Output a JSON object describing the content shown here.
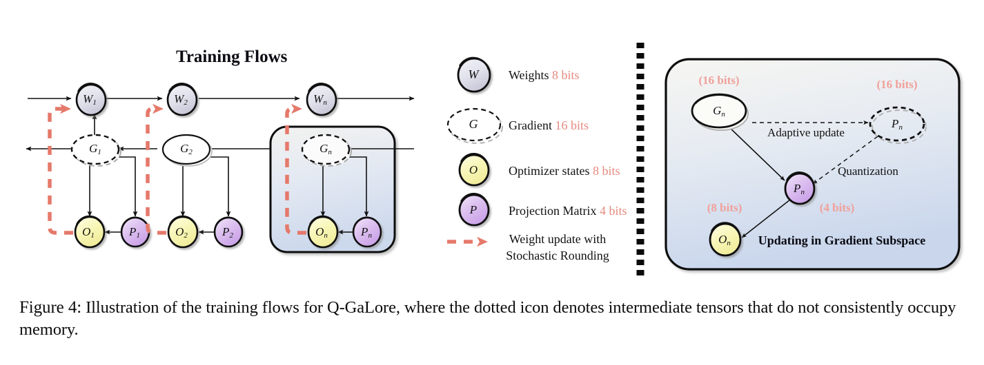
{
  "figure": {
    "caption_label": "Figure 4:",
    "caption_text": " Illustration of the training flows for Q-GaLore, where the dotted icon denotes intermediate tensors that do not consistently occupy memory."
  },
  "left_panel": {
    "title": "Training Flows",
    "nodes": {
      "w1": "W",
      "w1_sub": "1",
      "w2": "W",
      "w2_sub": "2",
      "wn": "W",
      "wn_sub": "n",
      "g1": "G",
      "g1_sub": "1",
      "g2": "G",
      "g2_sub": "2",
      "gn": "G",
      "gn_sub": "n",
      "o1": "O",
      "o1_sub": "1",
      "o2": "O",
      "o2_sub": "2",
      "on": "O",
      "on_sub": "n",
      "p1": "P",
      "p1_sub": "1",
      "p2": "P",
      "p2_sub": "2",
      "pn": "P",
      "pn_sub": "n"
    }
  },
  "legend": {
    "items": [
      {
        "icon": "weights-node-icon",
        "symbol": "W",
        "label": "Weights",
        "bits": "8 bits"
      },
      {
        "icon": "gradient-node-icon",
        "symbol": "G",
        "label": "Gradient",
        "bits": "16 bits"
      },
      {
        "icon": "optimizer-node-icon",
        "symbol": "O",
        "label": "Optimizer states",
        "bits": "8 bits"
      },
      {
        "icon": "projection-node-icon",
        "symbol": "P",
        "label": "Projection Matrix",
        "bits": "4 bits"
      }
    ],
    "flow_legend": {
      "icon": "red-dashed-arrow-icon",
      "line1": "Weight update with",
      "line2": "Stochastic Rounding"
    }
  },
  "right_panel": {
    "title": "Updating in Gradient Subspace",
    "nodes": {
      "gn": "G",
      "gn_sub": "n",
      "pn_dashed": "P",
      "pn_dashed_sub": "n",
      "pn_solid": "P",
      "pn_solid_sub": "n",
      "on": "O",
      "on_sub": "n"
    },
    "bits": {
      "gn": "(16 bits)",
      "pn_dashed": "(16 bits)",
      "on": "(8 bits)",
      "pn_solid": "(4 bits)"
    },
    "edges": {
      "adaptive_update": "Adaptive update",
      "quantization": "Quantization"
    }
  },
  "colors": {
    "accent_red": "#e5796b",
    "bits_pink": "#f0a09a",
    "weights_fill": "#dcdce8",
    "optimizer_fill": "#f7f5b4",
    "projection_fill": "#d7b6ea",
    "panel_bg_top": "#f4f4f0",
    "panel_bg_bottom": "#ccd8ec"
  }
}
